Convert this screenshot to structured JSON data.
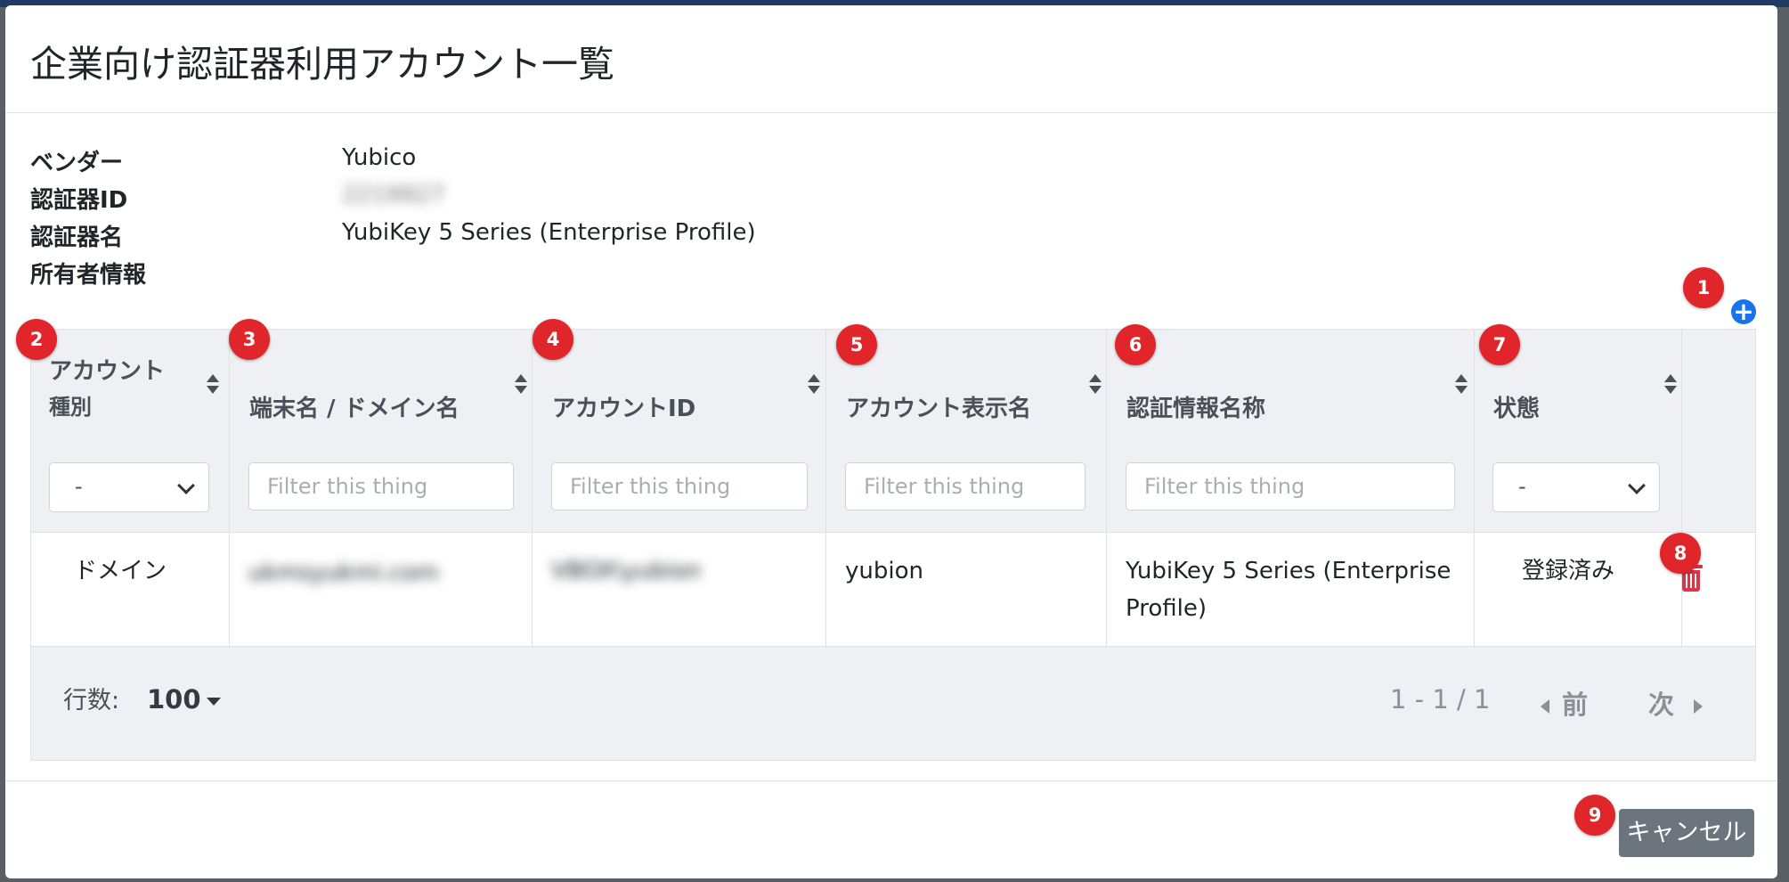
{
  "modal": {
    "title": "企業向け認証器利用アカウント一覧"
  },
  "info": [
    {
      "key": "ベンダー",
      "value": "Yubico"
    },
    {
      "key": "認証器ID",
      "value": "2219927"
    },
    {
      "key": "認証器名",
      "value": "YubiKey 5 Series (Enterprise Profile)"
    },
    {
      "key": "所有者情報",
      "value": ""
    }
  ],
  "table": {
    "headers": {
      "account_type": [
        "アカウント",
        "種別"
      ],
      "device_domain": "端末名 / ドメイン名",
      "account_id": "アカウントID",
      "display_name": "アカウント表示名",
      "credential_name": "認証情報名称",
      "status": "状態"
    },
    "filters": {
      "account_type_selected": "-",
      "status_selected": "-",
      "placeholder": "Filter this thing"
    },
    "rows": [
      {
        "account_type": "ドメイン",
        "device_domain": "ukmsyukmi.com",
        "account_id": "VBOX\\yubion",
        "display_name": "yubion",
        "credential_name": [
          "YubiKey 5 Series (Enterprise",
          "Profile)"
        ],
        "status": "登録済み"
      }
    ]
  },
  "footer": {
    "rows_label": "行数:",
    "rows_per_page": "100",
    "range": "1 - 1 / 1",
    "prev": "前",
    "next": "次"
  },
  "buttons": {
    "cancel": "キャンセル"
  },
  "badges": [
    "1",
    "2",
    "3",
    "4",
    "5",
    "6",
    "7",
    "8",
    "9"
  ],
  "icons": {
    "add": "plus-circle-icon",
    "delete": "trash-icon"
  },
  "colors": {
    "accent": "#1a73e8",
    "danger": "#dc3545",
    "badge": "#e0262a",
    "secondary_button": "#6c757d"
  }
}
